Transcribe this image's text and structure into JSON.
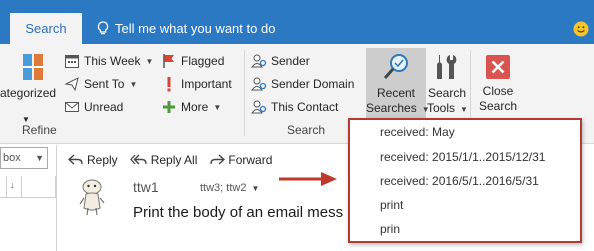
{
  "tabs": {
    "search": "Search",
    "tell_me": "Tell me what you want to do"
  },
  "ribbon": {
    "categorized_label": "ategorized",
    "refine_group_label": "Refine",
    "search_group_label": "Search",
    "refine": {
      "this_week": "This Week",
      "sent_to": "Sent To",
      "unread": "Unread",
      "flagged": "Flagged",
      "important": "Important",
      "more": "More"
    },
    "search_people": {
      "sender": "Sender",
      "sender_domain": "Sender Domain",
      "this_contact": "This Contact"
    },
    "recent_searches": {
      "line1": "Recent",
      "line2": "Searches"
    },
    "search_tools": {
      "line1": "Search",
      "line2": "Tools"
    },
    "close_search": {
      "line1": "Close",
      "line2": "Search"
    }
  },
  "left_pane": {
    "combo_value": "box"
  },
  "message": {
    "actions": {
      "reply": "Reply",
      "reply_all": "Reply All",
      "forward": "Forward"
    },
    "sender": "ttw1",
    "recipients": "ttw3; ttw2",
    "subject": "Print the body of an email mess"
  },
  "recent_searches_dropdown": {
    "items": [
      "received: May",
      "received: 2015/1/1..2015/12/31",
      "received: 2016/5/1..2016/5/31",
      "print",
      "prin"
    ]
  },
  "colors": {
    "tab_bar": "#2b79c2",
    "ribbon_bg": "#f3f3f3",
    "dropdown_border": "#b33a2e",
    "arrow": "#c0392b",
    "close_icon": "#d9534f"
  },
  "icons": [
    "lightbulb-icon",
    "smiley-icon",
    "categorize-icon",
    "calendar-icon",
    "sent-to-icon",
    "envelope-icon",
    "flag-icon",
    "important-icon",
    "plus-icon",
    "person-search-icon",
    "magnifier-icon",
    "tools-icon",
    "close-icon",
    "reply-icon",
    "reply-all-icon",
    "forward-icon",
    "arrow-icon"
  ]
}
